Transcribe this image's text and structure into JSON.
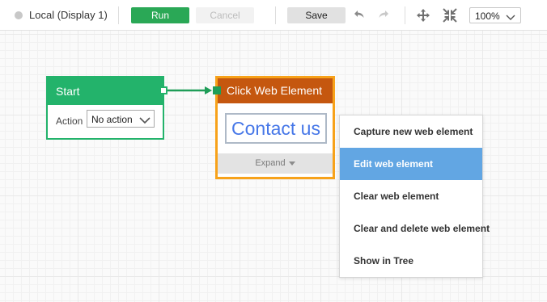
{
  "toolbar": {
    "environment": "Local (Display 1)",
    "run_label": "Run",
    "cancel_label": "Cancel",
    "save_label": "Save",
    "zoom_value": "100%",
    "colors": {
      "run": "#2aa856",
      "disabled": "#f2f2f2"
    },
    "icons": [
      "undo-icon",
      "redo-icon",
      "move-icon",
      "fit-screen-icon",
      "chevron-down-icon"
    ]
  },
  "start_node": {
    "title": "Start",
    "action_label": "Action",
    "action_value": "No action",
    "color": "#23b36b"
  },
  "click_node": {
    "title": "Click Web Element",
    "thumbnail_text": "Contact us",
    "expand_label": "Expand",
    "header_color": "#c5570f",
    "selection_color": "#f7a21a"
  },
  "context_menu": {
    "items": [
      {
        "label": "Capture new web element",
        "active": false
      },
      {
        "label": "Edit web element",
        "active": true
      },
      {
        "label": "Clear web element",
        "active": false
      },
      {
        "label": "Clear and delete web element",
        "active": false
      },
      {
        "label": "Show in Tree",
        "active": false
      }
    ],
    "highlight_color": "#62a6e3"
  }
}
